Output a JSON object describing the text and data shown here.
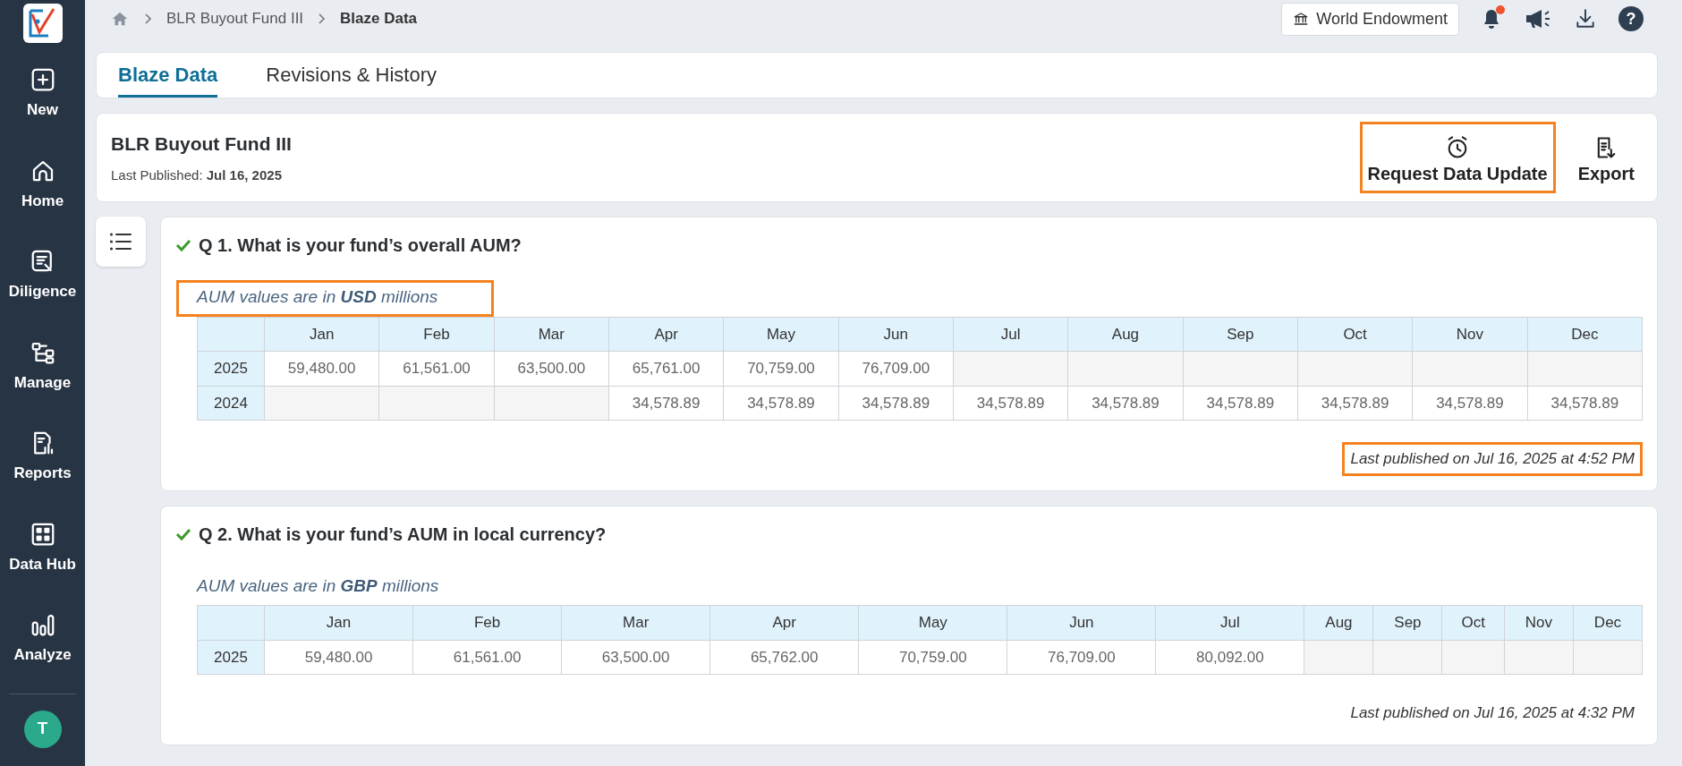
{
  "sidebar": {
    "items": [
      {
        "kind": "new",
        "label": "New"
      },
      {
        "kind": "home",
        "label": "Home"
      },
      {
        "kind": "diligence",
        "label": "Diligence"
      },
      {
        "kind": "manage",
        "label": "Manage"
      },
      {
        "kind": "reports",
        "label": "Reports"
      },
      {
        "kind": "datahub",
        "label": "Data Hub"
      },
      {
        "kind": "analyze",
        "label": "Analyze"
      }
    ],
    "avatar": "T"
  },
  "breadcrumb": [
    "BLR Buyout Fund III",
    "Blaze Data"
  ],
  "topbar": {
    "organization": "World Endowment",
    "notifications_unread": true,
    "help": "?"
  },
  "tabs": [
    {
      "label": "Blaze Data",
      "selected": true
    },
    {
      "label": "Revisions & History",
      "selected": false
    }
  ],
  "fund": {
    "title": "BLR Buyout Fund III",
    "published": "Last Published: **Jul 16, 2025**",
    "actions": [
      {
        "kind": "alarm",
        "label": "Request Data Update",
        "highlighted": true
      },
      {
        "kind": "export",
        "label": "Export",
        "highlighted": false
      }
    ]
  },
  "questions": [
    {
      "answered": true,
      "title": "Q 1. What is your fund’s overall AUM?",
      "note": "AUM values are in **USD** millions",
      "note_highlighted": true,
      "columns": [
        "Jan",
        "Feb",
        "Mar",
        "Apr",
        "May",
        "Jun",
        "Jul",
        "Aug",
        "Sep",
        "Oct",
        "Nov",
        "Dec"
      ],
      "rows": [
        {
          "year": "2025",
          "cells": [
            "59,480.00",
            "61,561.00",
            "63,500.00",
            "65,761.00",
            "70,759.00",
            "76,709.00",
            null,
            null,
            null,
            null,
            null,
            null
          ]
        },
        {
          "year": "2024",
          "cells": [
            null,
            null,
            null,
            "34,578.89",
            "34,578.89",
            "34,578.89",
            "34,578.89",
            "34,578.89",
            "34,578.89",
            "34,578.89",
            "34,578.89",
            "34,578.89"
          ]
        }
      ],
      "footer": "Last published on Jul 16, 2025 at 4:52 PM",
      "footer_highlighted": true
    },
    {
      "answered": true,
      "title": "Q 2. What is your fund’s AUM in local currency?",
      "note": "AUM values are in **GBP** millions",
      "note_highlighted": false,
      "columns": [
        "Jan",
        "Feb",
        "Mar",
        "Apr",
        "May",
        "Jun",
        "Jul",
        "Aug",
        "Sep",
        "Oct",
        "Nov",
        "Dec"
      ],
      "rows": [
        {
          "year": "2025",
          "cells": [
            "59,480.00",
            "61,561.00",
            "63,500.00",
            "65,762.00",
            "70,759.00",
            "76,709.00",
            "80,092.00",
            null,
            null,
            null,
            null,
            null
          ]
        }
      ],
      "footer": "Last published on Jul 16, 2025 at 4:32 PM",
      "footer_highlighted": false
    }
  ]
}
